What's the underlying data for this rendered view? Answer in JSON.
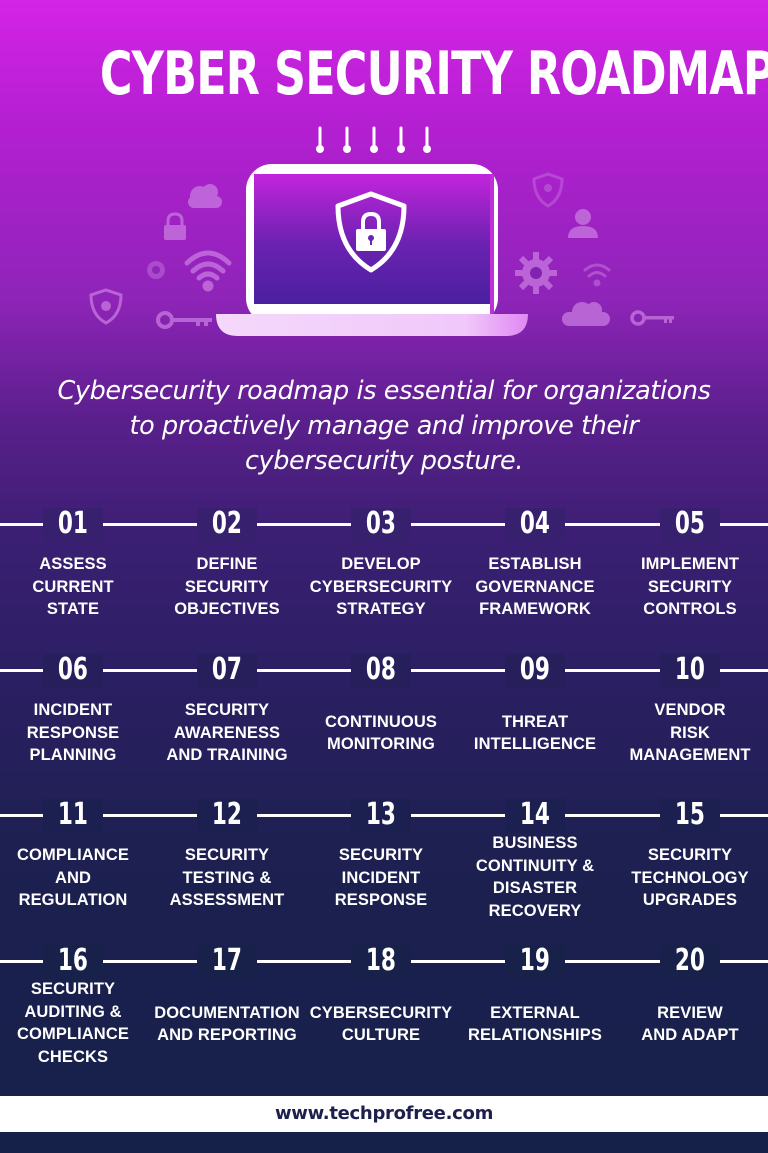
{
  "title": "CYBER SECURITY ROADMAP",
  "intro": {
    "line1": "Cybersecurity roadmap is essential for organizations",
    "line2": "to proactively manage and improve their",
    "line3": "cybersecurity posture."
  },
  "illustration": {
    "icons": [
      "laptop-icon",
      "shield-lock-icon",
      "cloud-icon",
      "lock-icon",
      "wifi-icon",
      "gear-icon",
      "shield-gear-icon",
      "key-icon",
      "user-icon"
    ]
  },
  "colors": {
    "background_top": "#d424e6",
    "background_bottom": "#16214a",
    "text": "#ffffff",
    "footer_text": "#1d1f4d"
  },
  "steps": [
    {
      "number": "01",
      "lines": [
        "ASSESS",
        "CURRENT",
        "STATE"
      ]
    },
    {
      "number": "02",
      "lines": [
        "DEFINE",
        "SECURITY",
        "OBJECTIVES"
      ]
    },
    {
      "number": "03",
      "lines": [
        "DEVELOP",
        "CYBERSECURITY",
        "STRATEGY"
      ]
    },
    {
      "number": "04",
      "lines": [
        "ESTABLISH",
        "GOVERNANCE",
        "FRAMEWORK"
      ]
    },
    {
      "number": "05",
      "lines": [
        "IMPLEMENT",
        "SECURITY",
        "CONTROLS"
      ]
    },
    {
      "number": "06",
      "lines": [
        "INCIDENT",
        "RESPONSE",
        "PLANNING"
      ]
    },
    {
      "number": "07",
      "lines": [
        "SECURITY",
        "AWARENESS",
        "AND TRAINING"
      ]
    },
    {
      "number": "08",
      "lines": [
        "CONTINUOUS",
        "MONITORING"
      ]
    },
    {
      "number": "09",
      "lines": [
        "THREAT",
        "INTELLIGENCE"
      ]
    },
    {
      "number": "10",
      "lines": [
        "VENDOR",
        "RISK",
        "MANAGEMENT"
      ]
    },
    {
      "number": "11",
      "lines": [
        "COMPLIANCE",
        "AND",
        "REGULATION"
      ]
    },
    {
      "number": "12",
      "lines": [
        "SECURITY",
        "TESTING &",
        "ASSESSMENT"
      ]
    },
    {
      "number": "13",
      "lines": [
        "SECURITY",
        "INCIDENT",
        "RESPONSE"
      ]
    },
    {
      "number": "14",
      "lines": [
        "BUSINESS",
        "CONTINUITY &",
        "DISASTER",
        "RECOVERY"
      ]
    },
    {
      "number": "15",
      "lines": [
        "SECURITY",
        "TECHNOLOGY",
        "UPGRADES"
      ]
    },
    {
      "number": "16",
      "lines": [
        "SECURITY",
        "AUDITING &",
        "COMPLIANCE",
        "CHECKS"
      ]
    },
    {
      "number": "17",
      "lines": [
        "DOCUMENTATION",
        "AND REPORTING"
      ]
    },
    {
      "number": "18",
      "lines": [
        "CYBERSECURITY",
        "CULTURE"
      ]
    },
    {
      "number": "19",
      "lines": [
        "EXTERNAL",
        "RELATIONSHIPS"
      ]
    },
    {
      "number": "20",
      "lines": [
        "REVIEW",
        "AND ADAPT"
      ]
    }
  ],
  "footer": {
    "url": "www.techprofree.com"
  }
}
